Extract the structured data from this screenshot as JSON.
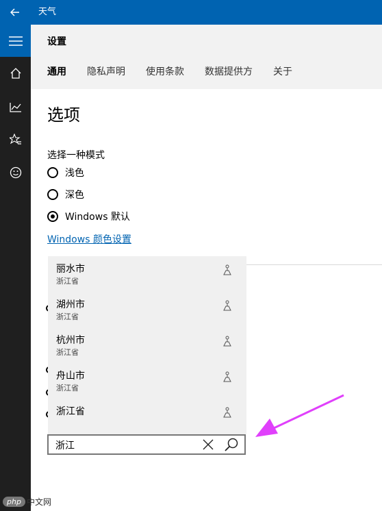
{
  "titlebar": {
    "back_icon": "back-arrow-icon",
    "title": "天气"
  },
  "nav": {
    "items": [
      {
        "icon": "hamburger-icon"
      },
      {
        "icon": "home-icon"
      },
      {
        "icon": "chart-icon"
      },
      {
        "icon": "star-list-icon"
      },
      {
        "icon": "smiley-icon"
      }
    ]
  },
  "header": {
    "title": "设置",
    "tabs": [
      {
        "label": "通用",
        "active": true
      },
      {
        "label": "隐私声明",
        "active": false
      },
      {
        "label": "使用条款",
        "active": false
      },
      {
        "label": "数据提供方",
        "active": false
      },
      {
        "label": "关于",
        "active": false
      }
    ]
  },
  "options": {
    "title": "选项",
    "mode_label": "选择一种模式",
    "modes": [
      {
        "label": "浅色",
        "checked": false
      },
      {
        "label": "深色",
        "checked": false
      },
      {
        "label": "Windows 默认",
        "checked": true
      }
    ],
    "color_link": "Windows 颜色设置"
  },
  "search": {
    "value": "浙江",
    "suggestions": [
      {
        "city": "丽水市",
        "province": "浙江省"
      },
      {
        "city": "湖州市",
        "province": "浙江省"
      },
      {
        "city": "杭州市",
        "province": "浙江省"
      },
      {
        "city": "舟山市",
        "province": "浙江省"
      },
      {
        "city": "浙江省",
        "province": ""
      }
    ]
  },
  "watermark": {
    "badge": "php",
    "text": "中文网"
  },
  "colors": {
    "accent": "#0063b1",
    "nav_bg": "#1f1f1f",
    "arrow": "#e040fb"
  }
}
